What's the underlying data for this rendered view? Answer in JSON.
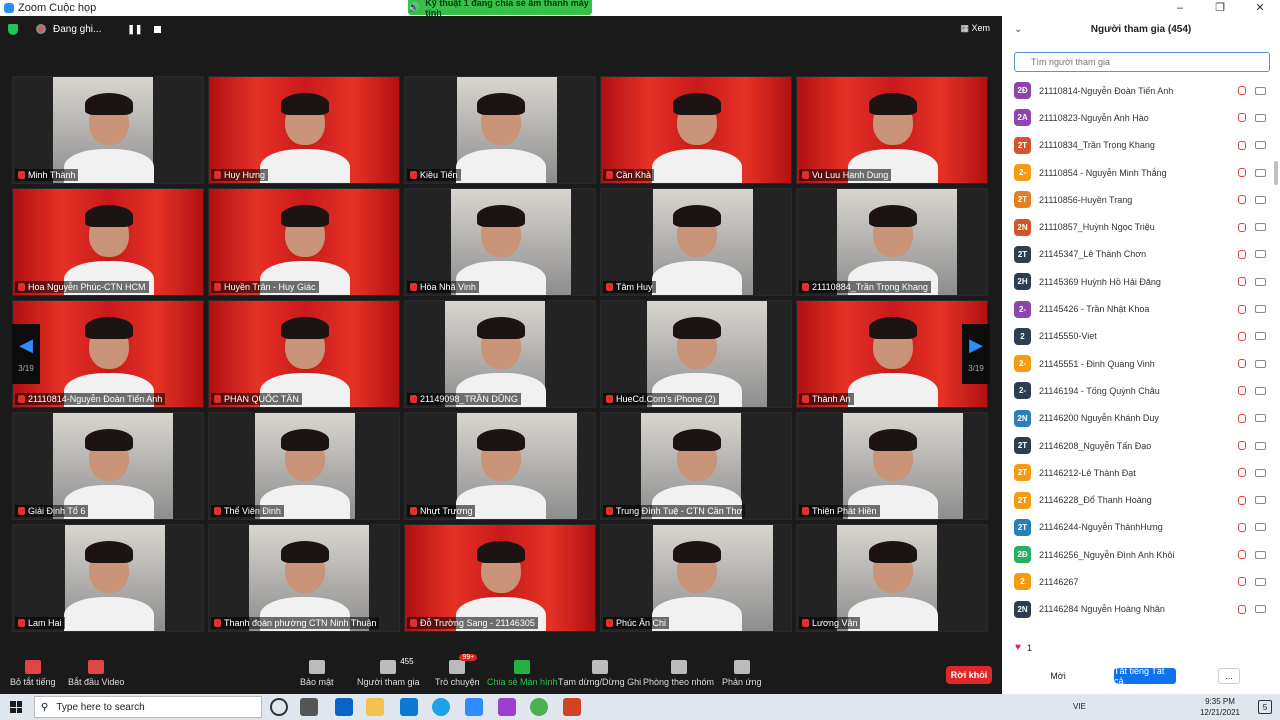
{
  "window": {
    "title": "Zoom Cuộc họp",
    "buttons": [
      "–",
      "❐",
      "✕"
    ]
  },
  "share_banner": "Kỹ thuật 1 đang chia sẻ âm thanh máy tính",
  "topbar": {
    "recording": "Đang ghi...",
    "view": "Xem"
  },
  "grid": {
    "page_indicator": "3/19",
    "tiles": [
      {
        "name": "Minh Thành"
      },
      {
        "name": "Huy Hưng"
      },
      {
        "name": "Kiều Tiến"
      },
      {
        "name": "Cần Khả"
      },
      {
        "name": "Vu Luu Hanh Dung"
      },
      {
        "name": "Hoa Nguyễn Phúc-CTN HCM"
      },
      {
        "name": "Huyền Trân - Huy Giác"
      },
      {
        "name": "Hòa Nhã Vinh"
      },
      {
        "name": "Tâm Huy"
      },
      {
        "name": "21110884_Trần Trọng Khang"
      },
      {
        "name": "21110814-Nguyễn Đoàn Tiến Anh"
      },
      {
        "name": "PHAN QUỐC TÂN"
      },
      {
        "name": "21149098_TRẦN DŨNG"
      },
      {
        "name": "HueCd.Com's iPhone (2)"
      },
      {
        "name": "Thành An"
      },
      {
        "name": "Giải Định Tổ 6"
      },
      {
        "name": "Thể Viên Đinh"
      },
      {
        "name": "Nhựt Trương"
      },
      {
        "name": "Trung Đình Tuệ - CTN Cần Thơ"
      },
      {
        "name": "Thiện Phát Hiền"
      },
      {
        "name": "Lam Hai"
      },
      {
        "name": "Thanh đoàn phường CTN Ninh Thuận"
      },
      {
        "name": "Đỗ Trường Sang - 21146305"
      },
      {
        "name": "Phúc Ân Chi"
      },
      {
        "name": "Lương Vân"
      }
    ]
  },
  "toolbar": {
    "mute": "Bỏ tắt tiếng",
    "video": "Bắt đầu Video",
    "security": "Bảo mật",
    "participants": "Người tham gia",
    "participants_count": "455",
    "chat": "Trò chuyện",
    "chat_badge": "99+",
    "share": "Chia sẻ Màn hình",
    "pause": "Tạm dừng/Dừng Ghi",
    "rooms": "Phòng theo nhóm",
    "reactions": "Phản ứng",
    "end": "Rời khỏi"
  },
  "panel": {
    "title": "Người tham gia (454)",
    "search_placeholder": "Tìm người tham gia",
    "participants": [
      {
        "initials": "2Đ",
        "name": "21110814-Nguyễn Đoàn Tiến Anh",
        "color": "#8e44ad"
      },
      {
        "initials": "2A",
        "name": "21110823-Nguyễn Anh Hào",
        "color": "#8e44ad"
      },
      {
        "initials": "2T",
        "name": "21110834_Trần Trọng Khang",
        "color": "#d35428"
      },
      {
        "initials": "2-",
        "name": "21110854 - Nguyễn Minh Thắng",
        "color": "#f39c12"
      },
      {
        "initials": "2T",
        "name": "21110856-Huyền Trang",
        "color": "#e67e22"
      },
      {
        "initials": "2N",
        "name": "21110857_Huỳnh Ngọc Triệu",
        "color": "#d35428"
      },
      {
        "initials": "2T",
        "name": "21145347_Lê Thành Chơn",
        "color": "#2c3e50"
      },
      {
        "initials": "2H",
        "name": "21145369 Huỳnh Hồ Hải Đăng",
        "color": "#2c3e50"
      },
      {
        "initials": "2-",
        "name": "21145426 - Trần Nhật Khoa",
        "color": "#8e44ad"
      },
      {
        "initials": "2",
        "name": "21145550-Viet",
        "color": "#2c3e50"
      },
      {
        "initials": "2-",
        "name": "21145551 - Đinh Quang Vinh",
        "color": "#f39c12"
      },
      {
        "initials": "2-",
        "name": "21146194 - Tống Quỳnh Châu",
        "color": "#2c3e50"
      },
      {
        "initials": "2N",
        "name": "21146200 Nguyễn Khánh Duy",
        "color": "#2980b9"
      },
      {
        "initials": "2T",
        "name": "21146208_Nguyễn Tấn Đạo",
        "color": "#2c3e50"
      },
      {
        "initials": "2T",
        "name": "21146212-Lê Thành Đạt",
        "color": "#f39c12"
      },
      {
        "initials": "2T",
        "name": "21146228_Đổ Thanh Hoàng",
        "color": "#f39c12"
      },
      {
        "initials": "2T",
        "name": "21146244-Nguyễn ThànhHưng",
        "color": "#2980b9"
      },
      {
        "initials": "2Đ",
        "name": "21146256_Nguyễn Đình Anh Khôi",
        "color": "#27ae60"
      },
      {
        "initials": "2",
        "name": "21146267",
        "color": "#f39c12"
      },
      {
        "initials": "2N",
        "name": "21146284 Nguyễn Hoàng Nhân",
        "color": "#2c3e50"
      }
    ],
    "reaction_count": "1",
    "invite": "Mời",
    "mute_all": "Tắt tiếng Tất cả",
    "more": "..."
  },
  "taskbar": {
    "search_placeholder": "Type here to search",
    "lang": "VIE",
    "time": "9:35 PM",
    "date": "12/21/2021",
    "notif": "5"
  }
}
